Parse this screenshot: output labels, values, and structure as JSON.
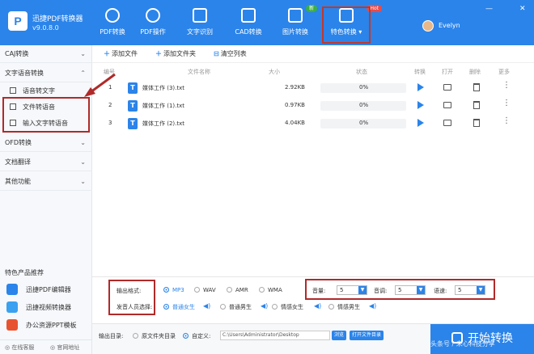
{
  "app": {
    "name": "迅捷PDF转换器",
    "version": "v9.0.8.0",
    "logo": "P"
  },
  "nav": [
    {
      "label": "PDF转换",
      "icon": "refresh-icon"
    },
    {
      "label": "PDF操作",
      "icon": "cog-icon"
    },
    {
      "label": "文字识别",
      "icon": "text-icon"
    },
    {
      "label": "CAD转换",
      "icon": "cad-icon"
    },
    {
      "label": "图片转换",
      "icon": "image-icon"
    },
    {
      "label": "特色转换",
      "icon": "special-icon",
      "badge": "Hot"
    }
  ],
  "nav_badge_new": "新",
  "user": {
    "name": "Evelyn"
  },
  "window_controls": {
    "min": "—",
    "close": "✕"
  },
  "sidebar": {
    "sections": [
      {
        "label": "CAJ转换",
        "chevron": "⌄"
      },
      {
        "label": "文字语音转换",
        "chevron": "⌃"
      },
      {
        "label": "OFD转换",
        "chevron": "⌄"
      },
      {
        "label": "文档翻译",
        "chevron": "⌄"
      },
      {
        "label": "其他功能",
        "chevron": "⌄"
      }
    ],
    "sub_items": [
      {
        "label": "语音转文字"
      },
      {
        "label": "文件转语音"
      },
      {
        "label": "输入文字转语音"
      }
    ],
    "products_title": "特色产品推荐",
    "products": [
      {
        "label": "迅捷PDF编辑器",
        "color": "#2b84ea"
      },
      {
        "label": "迅捷视频转换器",
        "color": "#3aa0f0"
      },
      {
        "label": "办公资源PPT模板",
        "color": "#e8532f"
      }
    ],
    "footer": {
      "online_consult": "在线客服",
      "official_site": "官网地址"
    }
  },
  "toolbar": {
    "add_file": "添加文件",
    "add_folder": "添加文件夹",
    "clear_list": "清空列表"
  },
  "table": {
    "headers": {
      "index": "编号",
      "name": "文件名称",
      "size": "大小",
      "status": "状态",
      "convert": "转换",
      "open": "打开",
      "delete": "删除",
      "more": "更多"
    },
    "rows": [
      {
        "index": "1",
        "name": "媒体工作 (3).txt",
        "size": "2.92KB",
        "progress": "0%"
      },
      {
        "index": "2",
        "name": "媒体工作 (1).txt",
        "size": "0.97KB",
        "progress": "0%"
      },
      {
        "index": "3",
        "name": "媒体工作 (2).txt",
        "size": "4.04KB",
        "progress": "0%"
      }
    ]
  },
  "settings": {
    "format_label": "输出格式:",
    "formats": [
      "MP3",
      "WAV",
      "AMR",
      "WMA"
    ],
    "speaker_label": "发音人员选择:",
    "speakers": [
      "普通女生",
      "普通男生",
      "情感女生",
      "情感男生"
    ],
    "volume_label": "音量:",
    "volume": "5",
    "pitch_label": "音调:",
    "pitch": "5",
    "speed_label": "语速:",
    "speed": "5"
  },
  "output": {
    "dir_label": "输出目录:",
    "source_dir": "原文件夹目录",
    "custom": "自定义:",
    "path": "C:\\Users\\Administrator\\Desktop",
    "browse": "浏览",
    "open_folder": "打开文件目录",
    "convert": "开始转换"
  },
  "watermark": "头条号 / 未心科技分享",
  "colors": {
    "primary": "#2b84ea",
    "annotation": "#b02a2a"
  }
}
